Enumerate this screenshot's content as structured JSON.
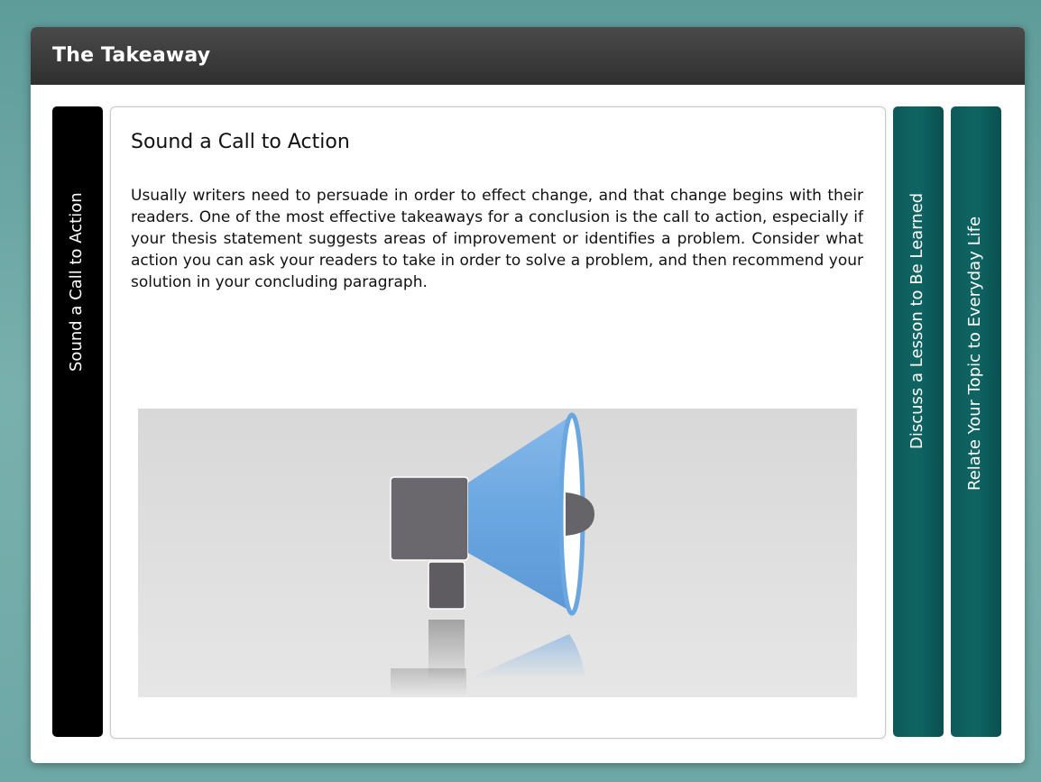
{
  "header": {
    "title": "The Takeaway"
  },
  "tabs": [
    {
      "label": "Sound a Call to Action",
      "active": true
    },
    {
      "label": "Discuss a Lesson to Be Learned",
      "active": false
    },
    {
      "label": "Relate Your Topic to Everyday Life",
      "active": false
    }
  ],
  "content": {
    "title": "Sound a Call to Action",
    "body": "Usually writers need to persuade in order to effect change, and that change begins with their readers. One of the most effective takeaways for a conclusion is the call to action, especially if your thesis statement suggests areas of improvement or identifies a problem. Consider what action you can ask your readers to take in order to solve a problem, and then recommend your solution in your concluding paragraph.",
    "illustration_icon": "megaphone-icon"
  },
  "colors": {
    "background": "#6ea8a6",
    "title_bar": "#333333",
    "active_tab": "#000000",
    "inactive_tab": "#0f6563",
    "megaphone_blue": "#6aa6e0",
    "megaphone_gray": "#6a686c"
  }
}
